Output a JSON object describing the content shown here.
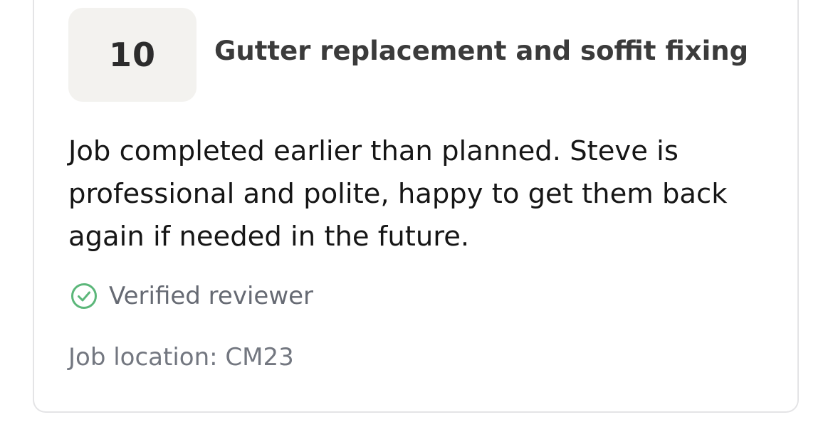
{
  "review": {
    "score": "10",
    "title": "Gutter replacement and soffit fixing",
    "text": "Job completed earlier than planned. Steve is professional and polite, happy to get them back again if needed in the future.",
    "verified_label": "Verified reviewer",
    "verified_icon": "check-circle-icon",
    "location": "Job location: CM23"
  },
  "colors": {
    "verified_icon": "#5cb77a",
    "score_background": "#f3f2ef",
    "card_border": "#e4e4e6"
  }
}
